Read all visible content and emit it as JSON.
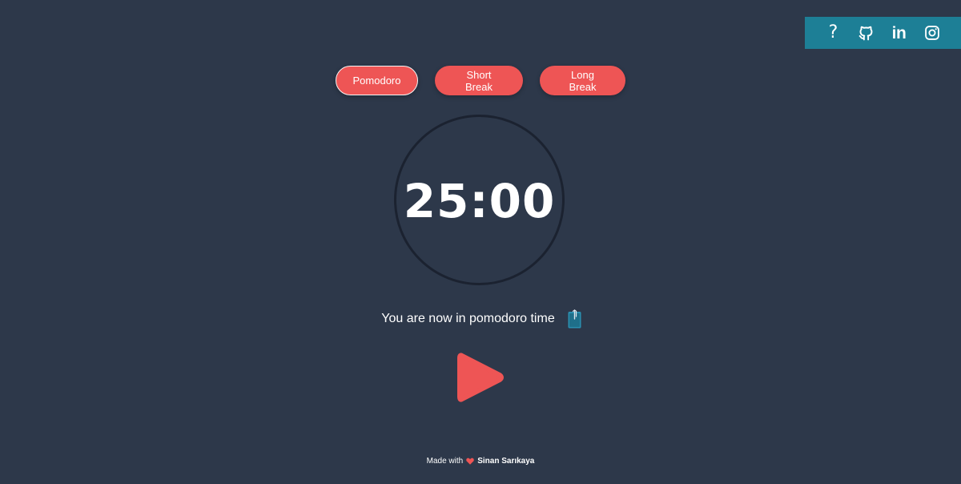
{
  "social": {
    "help_symbol": "?",
    "linkedin_symbol": "in",
    "icons": [
      "help-icon",
      "github-icon",
      "linkedin-icon",
      "instagram-icon"
    ],
    "bar_color": "#1d7f96"
  },
  "tabs": [
    {
      "label": "Pomodoro",
      "active": true
    },
    {
      "label": "Short Break",
      "active": false
    },
    {
      "label": "Long Break",
      "active": false
    }
  ],
  "timer": {
    "time": "25:00"
  },
  "status": {
    "message": "You are now in pomodoro time",
    "icon": "clipboard-icon"
  },
  "controls": {
    "play_icon": "play-icon"
  },
  "footer": {
    "prefix": "Made with",
    "icon": "heart-icon",
    "author": "Sinan Sarıkaya"
  },
  "colors": {
    "background": "#2d384a",
    "accent": "#ee5555",
    "social_bar": "#1d7f96",
    "ring": "#1b2230"
  }
}
